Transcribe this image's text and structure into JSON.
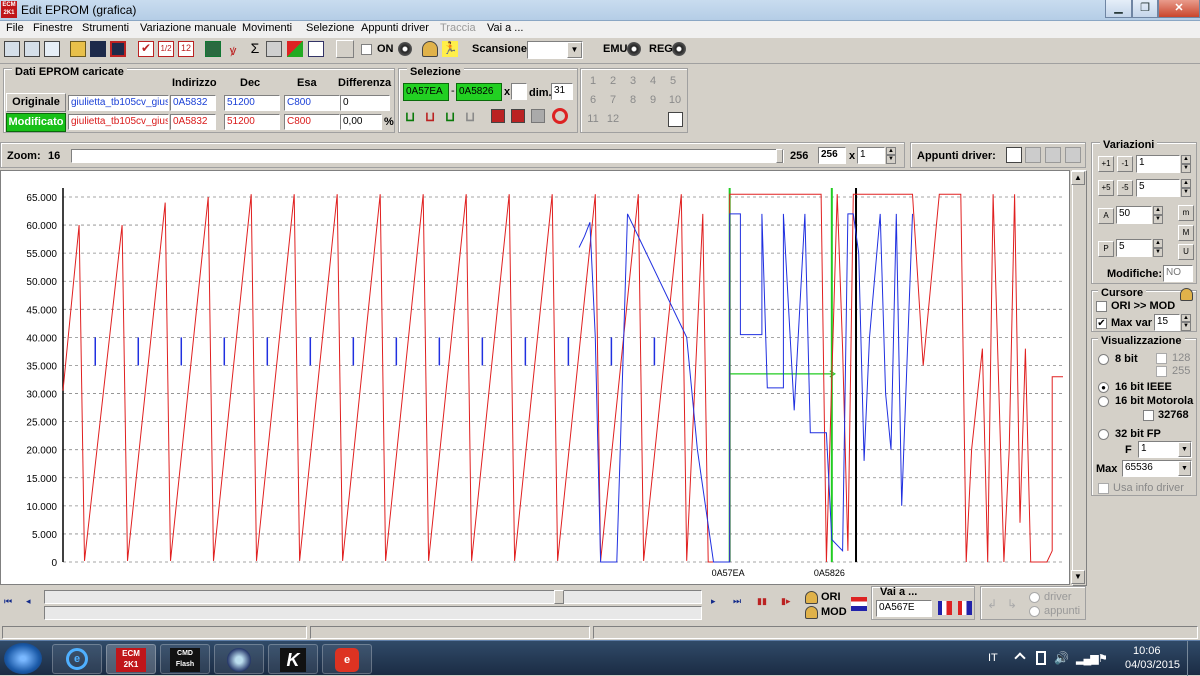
{
  "window": {
    "title": "Edit EPROM (grafica)",
    "app_icon_text": "ECM 2K1"
  },
  "menu": [
    "File",
    "Finestre",
    "Strumenti",
    "Variazione manuale",
    "Movimenti",
    "Selezione",
    "Appunti driver",
    "Traccia",
    "Vai a ..."
  ],
  "toolbar": {
    "on_label": "ON",
    "scansione_label": "Scansione",
    "emu_label": "EMU",
    "reg_label": "REG"
  },
  "eprom": {
    "group_title": "Dati EPROM caricate",
    "col_headers": [
      "Indirizzo",
      "Dec",
      "Esa",
      "Differenza"
    ],
    "original": {
      "button": "Originale",
      "file": "giulietta_tb105cv_gius",
      "addr": "0A5832",
      "dec": "51200",
      "esa": "C800",
      "diff": "0"
    },
    "modified": {
      "button": "Modificato",
      "file": "giulietta_tb105cv_gius",
      "addr": "0A5832",
      "dec": "51200",
      "esa": "C800",
      "diff": "0,00",
      "diff_unit": "%"
    }
  },
  "selection": {
    "title": "Selezione",
    "from": "0A57EA",
    "to": "0A5826",
    "x_label": "x",
    "dim_label": "dim.",
    "dim": "31",
    "sep": "-"
  },
  "numgrid": [
    "1",
    "2",
    "3",
    "4",
    "5",
    "6",
    "7",
    "8",
    "9",
    "10",
    "11",
    "12"
  ],
  "zoom": {
    "label": "Zoom:",
    "min": "16",
    "max": "256",
    "value": "256",
    "mult_label": "x",
    "mult": "1",
    "appunti_label": "Appunti driver:"
  },
  "variazioni": {
    "title": "Variazioni",
    "v1": "1",
    "v2": "5",
    "v3": "50",
    "v4": "5",
    "modifiche_label": "Modifiche:",
    "modifiche": "NO"
  },
  "cursore": {
    "title": "Cursore",
    "ori_mod": "ORI >> MOD",
    "max_var_label": "Max var",
    "max_var": "15"
  },
  "visual": {
    "title": "Visualizzazione",
    "b8": "8 bit",
    "b128": "128",
    "b255": "255",
    "b16ieee": "16 bit IEEE",
    "b16mot": "16 bit Motorola",
    "b32768": "32768",
    "b32fp": "32 bit FP",
    "f_label": "F",
    "f_val": "1",
    "max_label": "Max",
    "max_val": "65536",
    "usa_info": "Usa info driver"
  },
  "nav": {
    "ori": "ORI",
    "mod": "MOD",
    "vai_a_label": "Vai a ...",
    "vai_a_value": "0A567E",
    "driver": "driver",
    "appunti": "appunti"
  },
  "taskbar": {
    "lang": "IT",
    "time": "10:06",
    "date": "04/03/2015"
  },
  "chart_data": {
    "type": "line",
    "y_ticks": [
      "0",
      "5.000",
      "10.000",
      "15.000",
      "20.000",
      "25.000",
      "30.000",
      "35.000",
      "40.000",
      "45.000",
      "50.000",
      "55.000",
      "60.000",
      "65.000"
    ],
    "ylim": [
      0,
      65536
    ],
    "grid": true,
    "markers": [
      {
        "label": "0A57EA",
        "color": "#22cc22"
      },
      {
        "label": "0A5826",
        "color": "#22cc22"
      }
    ],
    "series": [
      {
        "color": "#e02020",
        "points": [
          [
            0,
            30500
          ],
          [
            3,
            60000
          ],
          [
            4,
            200
          ],
          [
            11,
            60000
          ],
          [
            12,
            200
          ],
          [
            19,
            64000
          ],
          [
            20,
            200
          ],
          [
            27,
            65000
          ],
          [
            28,
            200
          ],
          [
            35,
            65500
          ],
          [
            36,
            200
          ],
          [
            43,
            65500
          ],
          [
            44,
            200
          ],
          [
            51,
            65500
          ],
          [
            52,
            200
          ],
          [
            59,
            65500
          ],
          [
            60,
            200
          ],
          [
            67,
            65500
          ],
          [
            68,
            200
          ],
          [
            75,
            65500
          ],
          [
            76,
            200
          ],
          [
            83,
            65500
          ],
          [
            84,
            200
          ],
          [
            91,
            65500
          ],
          [
            92,
            200
          ],
          [
            99,
            65500
          ],
          [
            100,
            200
          ],
          [
            107,
            65500
          ],
          [
            108,
            200
          ],
          [
            115,
            65500
          ],
          [
            116,
            200
          ],
          [
            119,
            62000
          ],
          [
            120,
            0
          ],
          [
            124,
            0
          ],
          [
            124,
            65500
          ],
          [
            135,
            65500
          ],
          [
            141,
            65500
          ],
          [
            142,
            0
          ],
          [
            144,
            65500
          ],
          [
            145,
            38000
          ],
          [
            146,
            2000
          ],
          [
            147,
            65500
          ],
          [
            151,
            65500
          ],
          [
            153,
            65500
          ],
          [
            158,
            65500
          ],
          [
            160,
            35000
          ],
          [
            163,
            65500
          ],
          [
            167,
            65500
          ],
          [
            168,
            0
          ],
          [
            169,
            20000
          ],
          [
            171,
            38000
          ],
          [
            172,
            0
          ],
          [
            173,
            65500
          ],
          [
            175,
            0
          ],
          [
            176,
            20000
          ],
          [
            177,
            65500
          ],
          [
            178,
            7000
          ],
          [
            179,
            38000
          ],
          [
            180,
            0
          ],
          [
            183,
            0
          ],
          [
            184,
            2000
          ],
          [
            184,
            33000
          ],
          [
            186,
            33000
          ]
        ]
      },
      {
        "color": "#2030e0",
        "points": [
          [
            96,
            56000
          ],
          [
            97,
            58000
          ],
          [
            98,
            60500
          ],
          [
            99,
            40000
          ],
          [
            100,
            0
          ],
          [
            103,
            0
          ],
          [
            105,
            62000
          ],
          [
            116,
            40000
          ],
          [
            118,
            20000
          ],
          [
            121,
            0
          ],
          [
            124,
            0
          ],
          [
            124,
            62000
          ],
          [
            126,
            62000
          ],
          [
            126,
            40500
          ],
          [
            130,
            40500
          ],
          [
            130,
            62000
          ],
          [
            131,
            31000
          ],
          [
            134,
            31000
          ],
          [
            134,
            62000
          ],
          [
            136,
            27000
          ],
          [
            138,
            62000
          ],
          [
            139,
            23000
          ],
          [
            142,
            23000
          ],
          [
            143,
            4000
          ],
          [
            145,
            2000
          ],
          [
            146,
            62000
          ],
          [
            147,
            62000
          ],
          [
            148,
            55000
          ],
          [
            149,
            18000
          ],
          [
            150,
            40000
          ],
          [
            152,
            62000
          ],
          [
            153,
            30000
          ],
          [
            154,
            20000
          ],
          [
            155,
            62000
          ],
          [
            156,
            10000
          ],
          [
            158,
            62000
          ]
        ]
      }
    ],
    "arrow_value": 33500
  }
}
